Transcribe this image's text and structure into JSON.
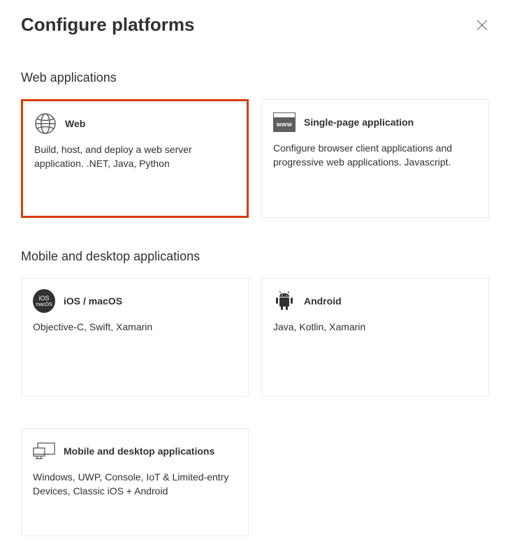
{
  "title": "Configure platforms",
  "sections": {
    "web": {
      "header": "Web applications",
      "cards": [
        {
          "title": "Web",
          "desc": "Build, host, and deploy a web server application. .NET, Java, Python"
        },
        {
          "title": "Single-page application",
          "desc": "Configure browser client applications and progressive web applications. Javascript."
        }
      ]
    },
    "mobile": {
      "header": "Mobile and desktop applications",
      "cards": [
        {
          "title": "iOS / macOS",
          "desc": "Objective-C, Swift, Xamarin"
        },
        {
          "title": "Android",
          "desc": "Java, Kotlin, Xamarin"
        },
        {
          "title": "Mobile and desktop applications",
          "desc": "Windows, UWP, Console, IoT & Limited-entry Devices, Classic iOS + Android"
        }
      ]
    }
  },
  "icons": {
    "ios_top": "iOS",
    "ios_bottom": "macOS",
    "www": "www"
  }
}
